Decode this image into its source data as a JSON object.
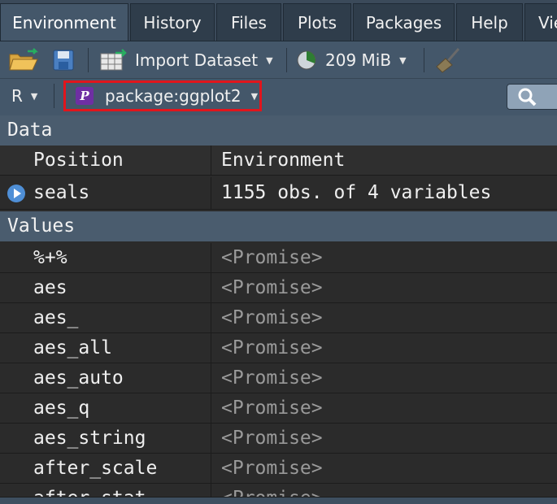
{
  "tabs": [
    {
      "label": "Environment",
      "active": true
    },
    {
      "label": "History"
    },
    {
      "label": "Files"
    },
    {
      "label": "Plots"
    },
    {
      "label": "Packages"
    },
    {
      "label": "Help"
    },
    {
      "label": "Vie"
    }
  ],
  "toolbar": {
    "import_label": "Import Dataset",
    "memory_label": "209 MiB"
  },
  "language_select": "R",
  "environment_select": "package:ggplot2",
  "sections": {
    "data": "Data",
    "values": "Values"
  },
  "columns": {
    "position": "Position",
    "environment": "Environment"
  },
  "data_rows": [
    {
      "name": "seals",
      "value": "1155 obs. of 4 variables"
    }
  ],
  "value_rows": [
    {
      "name": "%+%",
      "value": "<Promise>"
    },
    {
      "name": "aes",
      "value": "<Promise>"
    },
    {
      "name": "aes_",
      "value": "<Promise>"
    },
    {
      "name": "aes_all",
      "value": "<Promise>"
    },
    {
      "name": "aes_auto",
      "value": "<Promise>"
    },
    {
      "name": "aes_q",
      "value": "<Promise>"
    },
    {
      "name": "aes_string",
      "value": "<Promise>"
    },
    {
      "name": "after_scale",
      "value": "<Promise>"
    },
    {
      "name": "after_stat",
      "value": "<Promise>"
    }
  ],
  "colors": {
    "highlight_border": "#e1151c",
    "package_icon": "#6e2fa3",
    "play_icon": "#4f8fd6"
  }
}
